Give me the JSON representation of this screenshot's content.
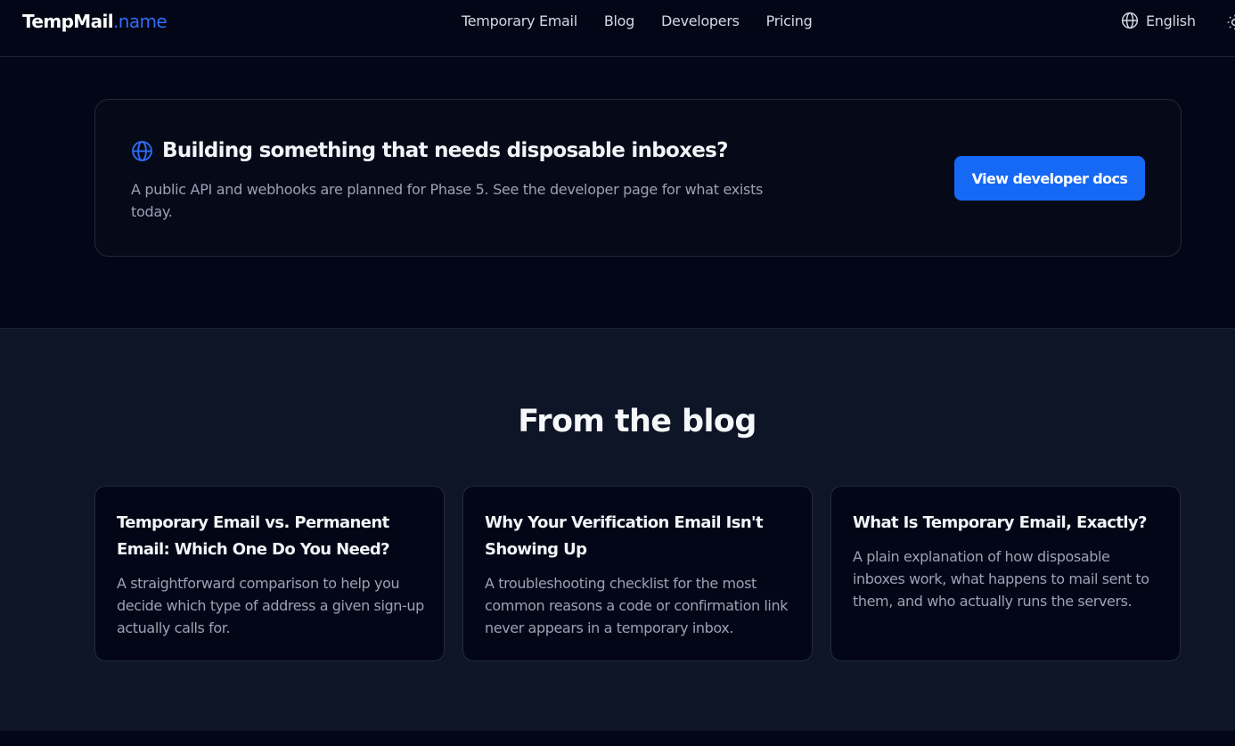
{
  "header": {
    "logo_main": "TempMail",
    "logo_accent": ".name",
    "nav": [
      {
        "label": "Temporary Email"
      },
      {
        "label": "Blog"
      },
      {
        "label": "Developers"
      },
      {
        "label": "Pricing"
      }
    ],
    "language": "English",
    "icons": {
      "language": "globe-icon",
      "theme": "sun-icon"
    }
  },
  "cta": {
    "icon": "globe-icon",
    "title": "Building something that needs disposable inboxes?",
    "description": "A public API and webhooks are planned for Phase 5. See the developer page for what exists today.",
    "button_label": "View developer docs"
  },
  "blog": {
    "heading": "From the blog",
    "posts": [
      {
        "title": "Temporary Email vs. Permanent Email: Which One Do You Need?",
        "excerpt": "A straightforward comparison to help you decide which type of address a given sign-up actually calls for."
      },
      {
        "title": "Why Your Verification Email Isn't Showing Up",
        "excerpt": "A troubleshooting checklist for the most common reasons a code or confirmation link never appears in a temporary inbox."
      },
      {
        "title": "What Is Temporary Email, Exactly?",
        "excerpt": "A plain explanation of how disposable inboxes work, what happens to mail sent to them, and who actually runs the servers."
      }
    ]
  },
  "colors": {
    "background": "#030616",
    "blog_background": "#0d1526",
    "accent": "#2f6df6",
    "button": "#1669f5"
  }
}
